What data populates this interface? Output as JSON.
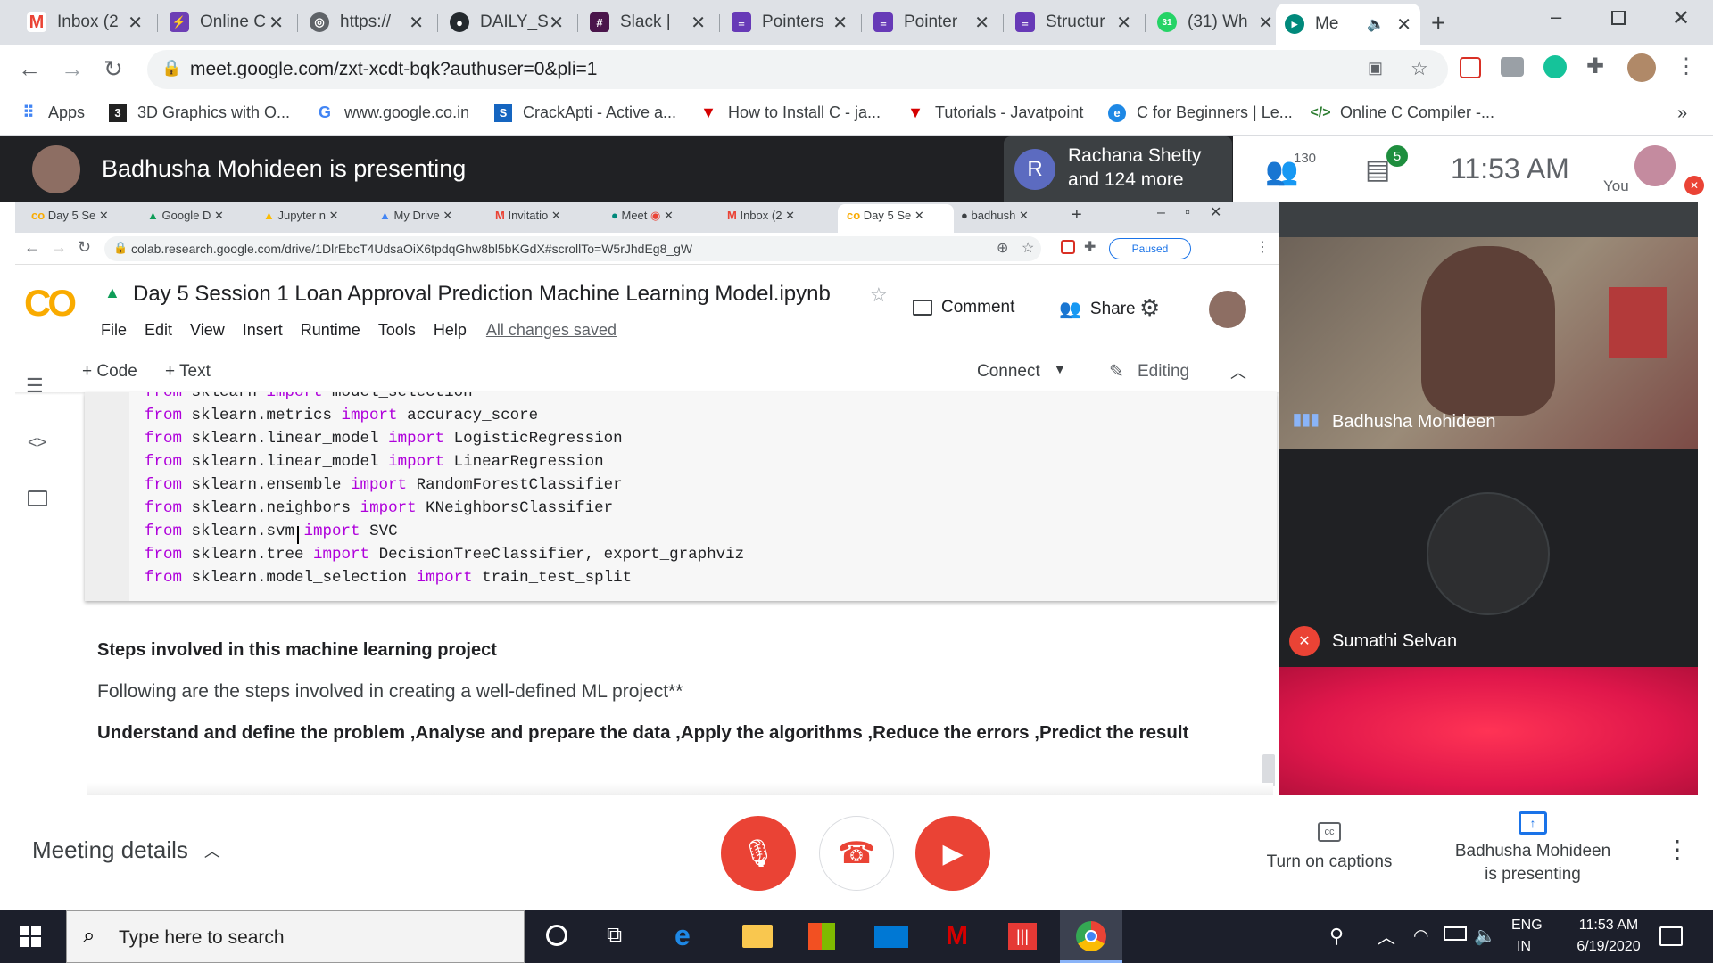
{
  "browser": {
    "tabs": [
      {
        "title": "Inbox (2",
        "icon": "gmail-icon"
      },
      {
        "title": "Online C",
        "icon": "lightning-icon"
      },
      {
        "title": "https://",
        "icon": "globe-icon"
      },
      {
        "title": "DAILY_S",
        "icon": "github-icon"
      },
      {
        "title": "Slack | ",
        "icon": "slack-icon"
      },
      {
        "title": "Pointers",
        "icon": "forms-icon"
      },
      {
        "title": "Pointer",
        "icon": "forms-icon"
      },
      {
        "title": "Structur",
        "icon": "forms-icon"
      },
      {
        "title": "(31) Wh",
        "icon": "whatsapp-icon"
      },
      {
        "title": "Me",
        "icon": "meet-icon",
        "active": true
      }
    ],
    "url": "meet.google.com/zxt-xcdt-bqk?authuser=0&pli=1",
    "bookmarks": [
      {
        "label": "Apps",
        "icon": "apps-grid-icon"
      },
      {
        "label": "3D Graphics with O...",
        "icon": "bookmark-3d-icon"
      },
      {
        "label": "www.google.co.in",
        "icon": "google-icon"
      },
      {
        "label": "CrackApti - Active a...",
        "icon": "crackapti-icon"
      },
      {
        "label": "How to Install C - ja...",
        "icon": "javatpoint-icon"
      },
      {
        "label": "Tutorials - Javatpoint",
        "icon": "javatpoint-icon"
      },
      {
        "label": "C for Beginners | Le...",
        "icon": "edureka-icon"
      },
      {
        "label": "Online C Compiler -...",
        "icon": "code-icon"
      }
    ],
    "more_bookmarks": "»"
  },
  "meet": {
    "presenting_banner": "Badhusha Mohideen is presenting",
    "participants_box": {
      "avatar_letter": "R",
      "line1": "Rachana Shetty",
      "line2": "and 124 more"
    },
    "participant_count": "130",
    "chat_badge": "5",
    "time": "11:53  AM",
    "you_label": "You",
    "tiles": [
      {
        "name": "Badhusha Mohideen",
        "status": "speaking"
      },
      {
        "name": "Sumathi Selvan",
        "status": "muted"
      }
    ],
    "bottom": {
      "meeting_details": "Meeting details",
      "captions": "Turn on captions",
      "presenting_line1": "Badhusha Mohideen",
      "presenting_line2": "is presenting"
    }
  },
  "shared_screen": {
    "tabs": [
      {
        "title": "Day 5 Se",
        "icon": "colab-icon"
      },
      {
        "title": "Google D",
        "icon": "drive-icon"
      },
      {
        "title": "Jupyter n",
        "icon": "drive-icon"
      },
      {
        "title": "My Drive",
        "icon": "drive-icon"
      },
      {
        "title": "Invitatio",
        "icon": "gmail-icon"
      },
      {
        "title": "Meet",
        "icon": "meet-icon"
      },
      {
        "title": "Inbox (2",
        "icon": "gmail-icon"
      },
      {
        "title": "Day 5 Se",
        "icon": "colab-icon",
        "active": true
      },
      {
        "title": "badhush",
        "icon": "github-icon"
      }
    ],
    "url": "colab.research.google.com/drive/1DlrEbcT4UdsaOiX6tpdqGhw8bl5bKGdX#scrollTo=W5rJhdEg8_gW",
    "paused_label": "Paused",
    "notebook": {
      "title": "Day 5 Session 1 Loan Approval Prediction Machine Learning Model.ipynb",
      "menus": [
        "File",
        "Edit",
        "View",
        "Insert",
        "Runtime",
        "Tools",
        "Help"
      ],
      "saved_status": "All changes saved",
      "comment": "Comment",
      "share": "Share",
      "add_code": "+ Code",
      "add_text": "+ Text",
      "connect": "Connect",
      "editing": "Editing",
      "code_lines": [
        {
          "a": "from",
          "b": " sklearn ",
          "c": "import",
          "d": " model_selection"
        },
        {
          "a": "from",
          "b": " sklearn.metrics ",
          "c": "import",
          "d": " accuracy_score"
        },
        {
          "a": "from",
          "b": " sklearn.linear_model ",
          "c": "import",
          "d": " LogisticRegression"
        },
        {
          "a": "from",
          "b": " sklearn.linear_model ",
          "c": "import",
          "d": " LinearRegression"
        },
        {
          "a": "from",
          "b": " sklearn.ensemble ",
          "c": "import",
          "d": " RandomForestClassifier"
        },
        {
          "a": "from",
          "b": " sklearn.neighbors ",
          "c": "import",
          "d": " KNeighborsClassifier"
        },
        {
          "a": "from",
          "b": " sklearn.svm ",
          "c": "import",
          "d": " SVC"
        },
        {
          "a": "from",
          "b": " sklearn.tree ",
          "c": "import",
          "d": " DecisionTreeClassifier, export_graphviz"
        },
        {
          "a": "from",
          "b": " sklearn.model_selection ",
          "c": "import",
          "d": " train_test_split"
        }
      ],
      "text_heading": "Steps involved in this machine learning project",
      "text_para": "Following are the steps involved in creating a well-defined ML project**",
      "text_bold": "Understand and define the problem ,Analyse and prepare the data ,Apply the algorithms ,Reduce the errors ,Predict the result"
    }
  },
  "taskbar": {
    "search_placeholder": "Type here to search",
    "lang1": "ENG",
    "lang2": "IN",
    "clock_time": "11:53 AM",
    "clock_date": "6/19/2020"
  },
  "colors": {
    "meet_red": "#ea4335",
    "meet_dark": "#202124",
    "colab_orange": "#f9ab00",
    "keyword": "#af00db",
    "link_blue": "#1a73e8"
  }
}
